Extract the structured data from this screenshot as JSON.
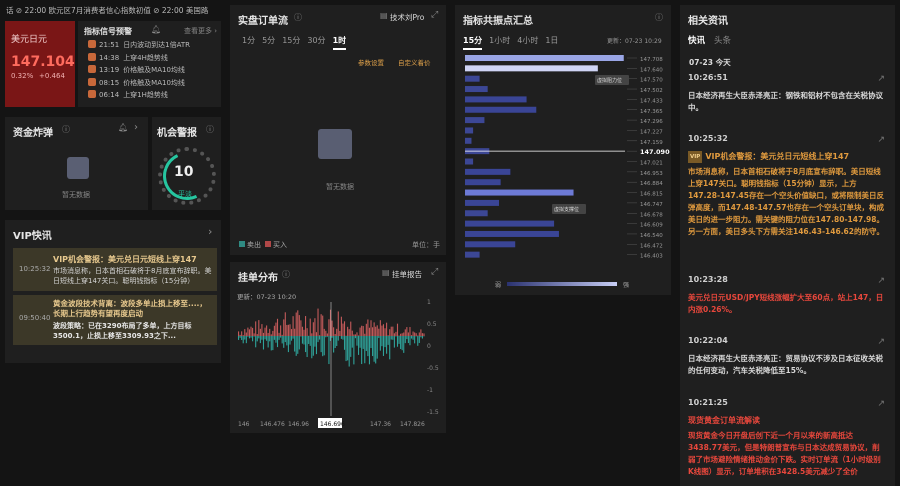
{
  "ticker": "话 ⊘ 22:00 欧元区7月消费者信心指数初值 ⊘ 22:00 美国路",
  "quote": {
    "name": "美元日元",
    "price": "147.104",
    "pct": "0.32%",
    "chg": "+0.464"
  },
  "signals": {
    "title": "指标信号预警",
    "more": "查看更多 ›",
    "rows": [
      {
        "time": "21:51",
        "text": "日内波动到达1倍ATR"
      },
      {
        "time": "14:38",
        "text": "上穿4H趋势线"
      },
      {
        "time": "13:19",
        "text": "价格触及MA10均线"
      },
      {
        "time": "08:15",
        "text": "价格触及MA10均线"
      },
      {
        "time": "06:14",
        "text": "上穿1H趋势线"
      }
    ]
  },
  "flow": {
    "title": "资金炸弹",
    "empty": "暂无数据"
  },
  "alert": {
    "title": "机会警报",
    "count": "10",
    "label": "平淡"
  },
  "vip": {
    "title": "VIP快讯",
    "items": [
      {
        "time": "10:25:32",
        "title": "VIP机会警报：美元兑日元短线上穿147",
        "body": "市场消息称，日本首相石破将于8月底宣布辞职。美日短线上穿147关口。聪明钱指标（15分钟）"
      },
      {
        "time": "09:50:40",
        "title": "黄金波段技术背离：波段多单止损上移至....，长期上行趋势有望再度启动",
        "body": "波段策略：已在3290布局了多单，上方目标3500.1，止损上移至3309.93之下..."
      }
    ]
  },
  "orders": {
    "title": "实盘订单流",
    "tech": "技术刘Pro",
    "tabs": [
      "1分",
      "5分",
      "15分",
      "30分",
      "1时"
    ],
    "active": 4,
    "param": "参数设置",
    "custom": "自定义着价",
    "empty": "暂无数据",
    "sell": "卖出",
    "buy": "买入",
    "unit": "单位：手"
  },
  "dist": {
    "title": "挂单分布",
    "report": "挂单报告",
    "updated": "更新：07-23 10:20",
    "xticks": [
      "146",
      "146.476",
      "146.96",
      "146.696",
      "147.36",
      "147.826"
    ],
    "yticks": [
      "1",
      "0.5",
      "0",
      "-0.5",
      "-1",
      "-1.5"
    ]
  },
  "levels": {
    "title": "指标共振点汇总",
    "tabs": [
      "15分",
      "1小时",
      "4小时",
      "1日"
    ],
    "active": 0,
    "updated": "更新：07-23 10:29",
    "prices": [
      "147.708",
      "147.640",
      "147.570",
      "147.502",
      "147.433",
      "147.365",
      "147.296",
      "147.227",
      "147.159",
      "147.090",
      "147.021",
      "146.953",
      "146.884",
      "146.815",
      "146.747",
      "146.678",
      "146.609",
      "146.540",
      "146.472",
      "146.403"
    ],
    "current": "147.090",
    "resist": "虚拟阻力位",
    "support": "虚拟支撑位",
    "weak": "弱",
    "strong": "强",
    "bars": [
      {
        "v": 0.98,
        "c": "#9aa6e6"
      },
      {
        "v": 0.82,
        "c": "#cfd4f5"
      },
      {
        "v": 0.09,
        "c": "#3c4795"
      },
      {
        "v": 0.14,
        "c": "#3c4795"
      },
      {
        "v": 0.38,
        "c": "#3a4596"
      },
      {
        "v": 0.44,
        "c": "#3a4596"
      },
      {
        "v": 0.12,
        "c": "#3c4795"
      },
      {
        "v": 0.05,
        "c": "#3c4795"
      },
      {
        "v": 0.04,
        "c": "#3c4795"
      },
      {
        "v": 0.15,
        "c": "#3c4795"
      },
      {
        "v": 0.05,
        "c": "#3c4795"
      },
      {
        "v": 0.28,
        "c": "#3a4596"
      },
      {
        "v": 0.22,
        "c": "#3a4596"
      },
      {
        "v": 0.67,
        "c": "#6d7ad6"
      },
      {
        "v": 0.21,
        "c": "#3a4596"
      },
      {
        "v": 0.14,
        "c": "#3c4795"
      },
      {
        "v": 0.55,
        "c": "#3a4596"
      },
      {
        "v": 0.58,
        "c": "#3a4596"
      },
      {
        "v": 0.31,
        "c": "#3a4596"
      },
      {
        "v": 0.09,
        "c": "#3c4795"
      }
    ]
  },
  "news": {
    "title": "相关资讯",
    "tabs": [
      "快讯",
      "头条"
    ],
    "date": "07-23 今天",
    "items": [
      {
        "time": "10:26:51",
        "vip": false,
        "color": "normal",
        "title": "",
        "body": "日本经济再生大臣赤泽亮正：钢铁和铝材不包含在关税协议中。"
      },
      {
        "time": "10:25:32",
        "vip": true,
        "color": "orange",
        "title": "VIP机会警报：美元兑日元短线上穿147",
        "body": "市场消息称，日本首相石破将于8月底宣布辞职。美日短线上穿147关口。聪明钱指标（15分钟）显示，上方147.28-147.45存在一个空头价值缺口，或将限制美日反弹高度，而147.48-147.57也存在一个空头订单块，构成美日的进一步阻力。需关键的阻力位在147.80-147.98。另一方面，美日多头下方需关注146.43-146.62的防守。"
      },
      {
        "time": "10:23:28",
        "vip": false,
        "color": "red",
        "title": "",
        "body": "美元兑日元USD/JPY短线涨幅扩大至60点，站上147，日内涨0.26%。"
      },
      {
        "time": "10:22:04",
        "vip": false,
        "color": "normal",
        "title": "",
        "body": "日本经济再生大臣赤泽亮正：贸易协议不涉及日本征收关税的任何变动，汽车关税降低至15%。"
      },
      {
        "time": "10:21:25",
        "vip": false,
        "color": "red",
        "title": "现货黄金订单流解读",
        "body": "现货黄金今日开盘后创下近一个月以来的新高抵达3438.77美元，但是特朗普宣布与日本达成贸易协议，削弱了市场避险情绪推动金价下跌。实时订单流（1小时级别K线图）显示，订单堆积在3428.5美元减少了全价"
      }
    ]
  }
}
